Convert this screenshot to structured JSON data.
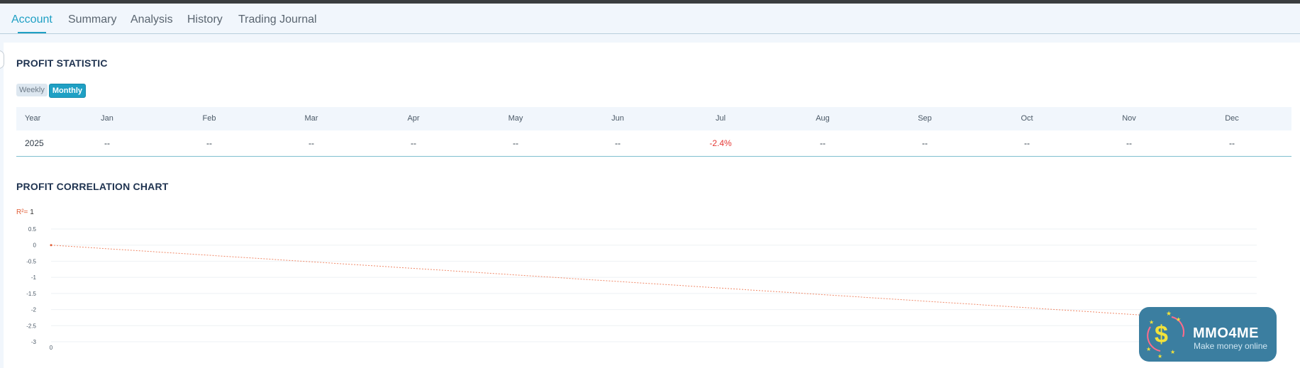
{
  "tabs": [
    {
      "label": "Account",
      "active": true
    },
    {
      "label": "Summary",
      "active": false
    },
    {
      "label": "Analysis",
      "active": false
    },
    {
      "label": "History",
      "active": false
    },
    {
      "label": "Trading Journal",
      "active": false
    }
  ],
  "profit_statistic": {
    "title": "PROFIT STATISTIC",
    "toggle": {
      "weekly": "Weekly",
      "monthly": "Monthly",
      "selected": "Monthly"
    },
    "headers": [
      "Year",
      "Jan",
      "Feb",
      "Mar",
      "Apr",
      "May",
      "Jun",
      "Jul",
      "Aug",
      "Sep",
      "Oct",
      "Nov",
      "Dec"
    ],
    "rows": [
      [
        "2025",
        "--",
        "--",
        "--",
        "--",
        "--",
        "--",
        "-2.4%",
        "--",
        "--",
        "--",
        "--",
        "--"
      ]
    ],
    "negative_color": "#e53935"
  },
  "correlation": {
    "title": "PROFIT CORRELATION CHART",
    "r2_label": "R²=",
    "r2_value": "1"
  },
  "chart_data": {
    "type": "scatter",
    "title": "",
    "xlabel": "",
    "ylabel": "",
    "x_ticks": [
      "0"
    ],
    "y_ticks": [
      0.5,
      0,
      -0.5,
      -1,
      -1.5,
      -2,
      -2.5,
      -3
    ],
    "ylim": [
      -3,
      0.5
    ],
    "grid": true,
    "points": [
      {
        "x": 0,
        "y": 0
      },
      {
        "x": 1,
        "y": -2.4
      }
    ],
    "trendline": {
      "from": [
        0,
        0
      ],
      "to": [
        1,
        -2.4
      ],
      "color": "#f08a6a"
    }
  },
  "watermark": {
    "brand": "MMO4ME",
    "tagline": "Make money online",
    "symbol": "$"
  }
}
